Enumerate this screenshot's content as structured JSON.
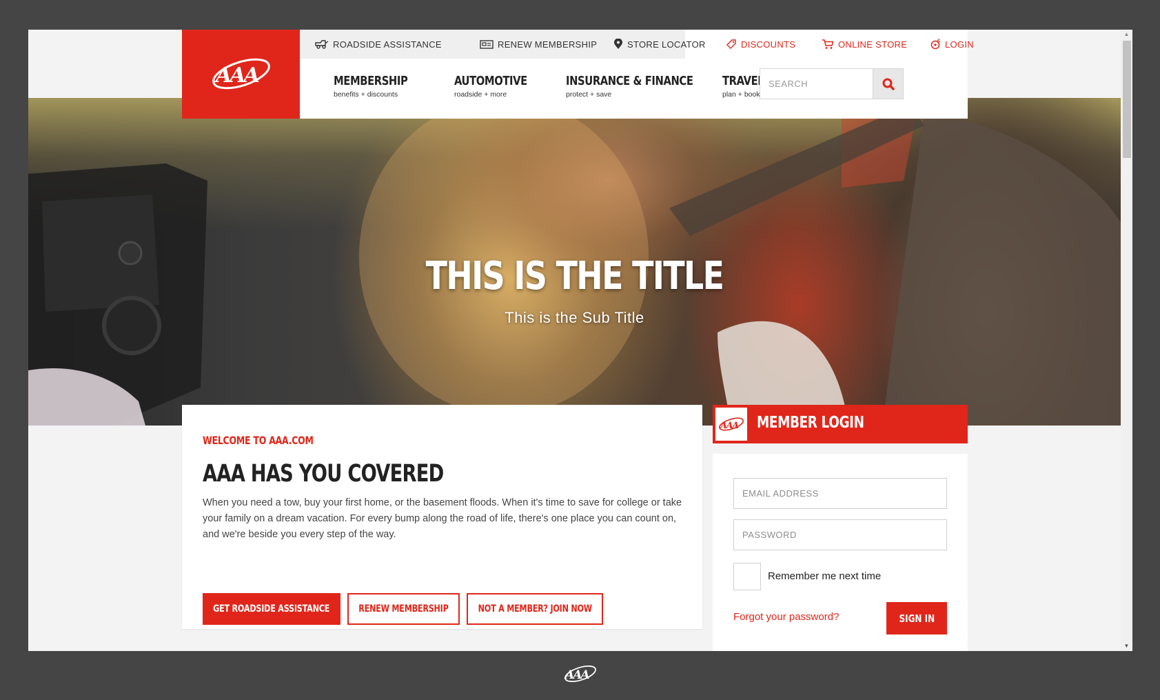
{
  "utility_nav": {
    "roadside": "ROADSIDE ASSISTANCE",
    "renew": "RENEW MEMBERSHIP",
    "store_locator": "STORE LOCATOR",
    "discounts": "DISCOUNTS",
    "online_store": "ONLINE STORE",
    "login": "LOGIN"
  },
  "main_nav": [
    {
      "title": "MEMBERSHIP",
      "sub": "benefits + discounts"
    },
    {
      "title": "AUTOMOTIVE",
      "sub": "roadside + more"
    },
    {
      "title": "INSURANCE & FINANCE",
      "sub": "protect + save"
    },
    {
      "title": "TRAVEL",
      "sub": "plan + book"
    }
  ],
  "search": {
    "placeholder": "SEARCH"
  },
  "hero": {
    "title": "THIS IS THE TITLE",
    "subtitle": "This is the Sub Title"
  },
  "welcome": {
    "eyebrow": "WELCOME TO AAA.COM",
    "heading": "AAA HAS YOU COVERED",
    "body": "When you need a tow, buy your first home, or the basement floods. When it's time to save for college or take your family on a dream vacation. For every bump along the road of life, there's one place you can count on, and we're beside you every step of the way.",
    "buttons": {
      "roadside": "GET ROADSIDE ASSISTANCE",
      "renew": "RENEW MEMBERSHIP",
      "join": "NOT A MEMBER? JOIN NOW"
    }
  },
  "login": {
    "title": "MEMBER LOGIN",
    "email_placeholder": "EMAIL ADDRESS",
    "password_placeholder": "PASSWORD",
    "remember_label": "Remember me next time",
    "forgot_link": "Forgot your password?",
    "sign_in": "SIGN IN"
  },
  "colors": {
    "brand_red": "#e0261a",
    "frame": "#454545",
    "page_bg": "#f3f3f3"
  },
  "icons": [
    "aaa-logo",
    "tow-truck-icon",
    "membership-card-icon",
    "map-pin-icon",
    "tag-icon",
    "cart-icon",
    "login-icon",
    "search-icon"
  ]
}
